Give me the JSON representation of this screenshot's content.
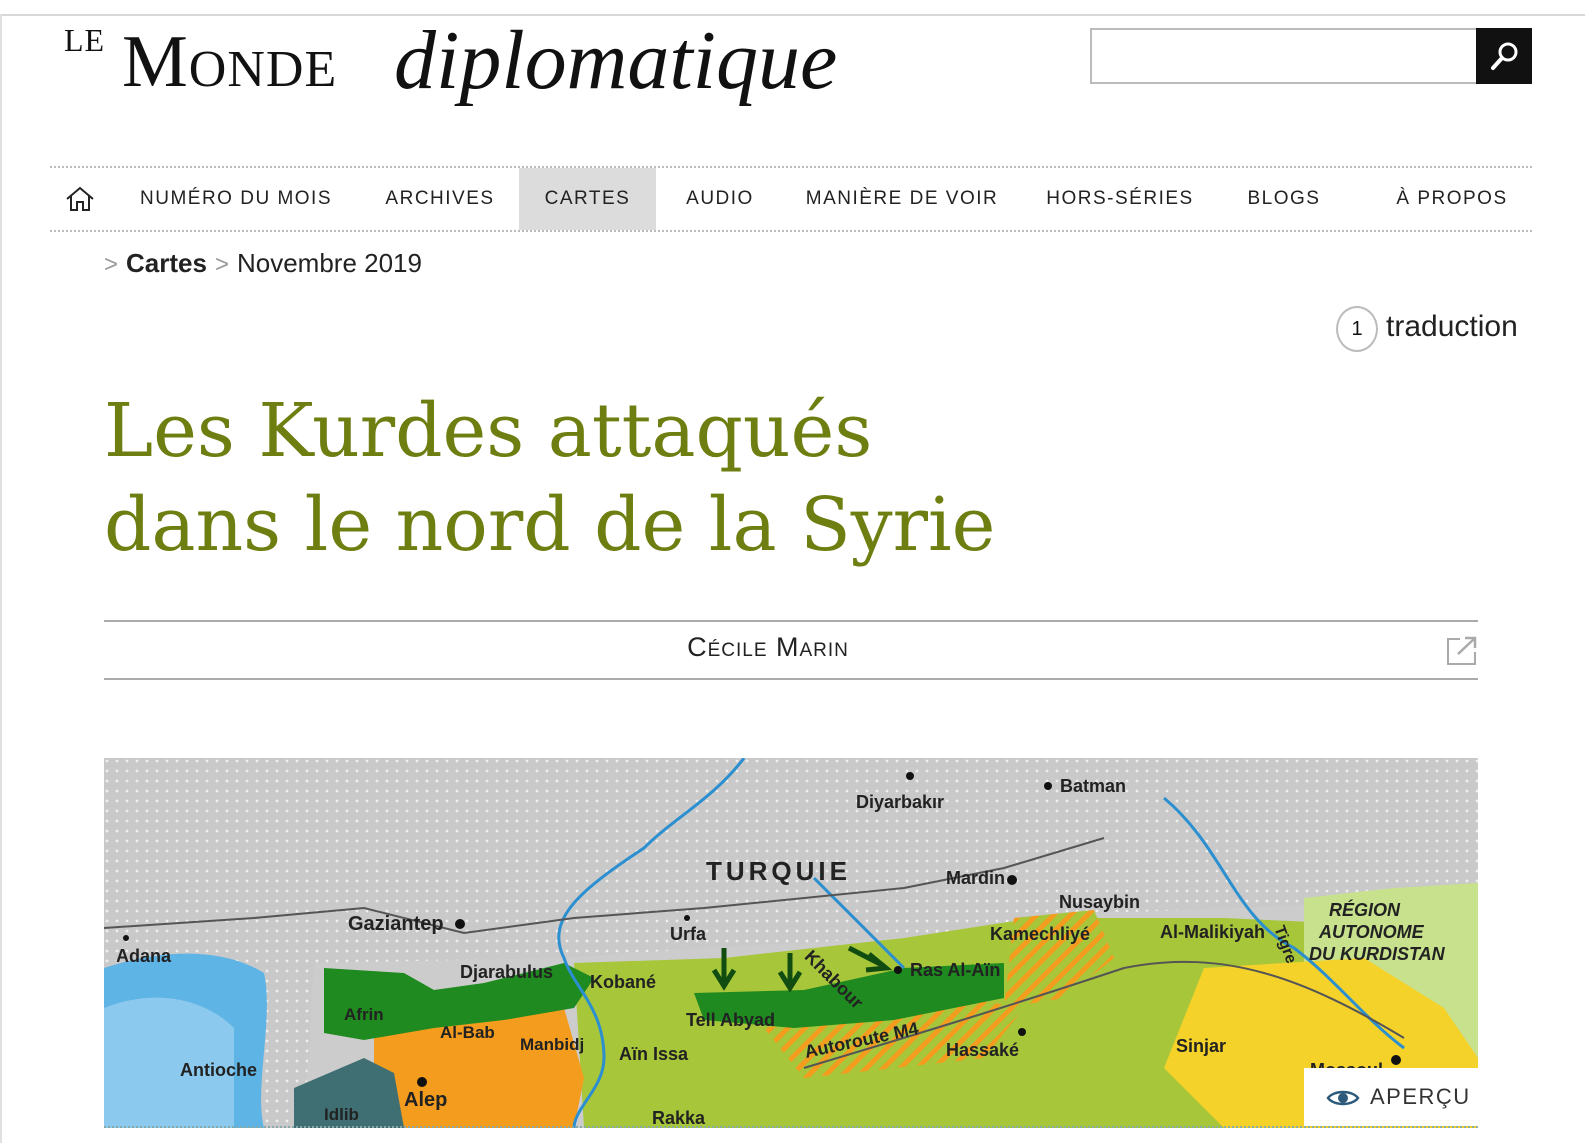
{
  "logo": {
    "le": "LE",
    "monde": "Monde",
    "diplomatique": "diplomatique"
  },
  "search": {
    "placeholder": "",
    "value": "",
    "icon": "search-icon"
  },
  "nav": {
    "home_icon": "home-icon",
    "items": [
      "NUMÉRO DU MOIS",
      "ARCHIVES",
      "CARTES",
      "AUDIO",
      "MANIÈRE DE VOIR",
      "HORS-SÉRIES",
      "BLOGS",
      "À PROPOS"
    ],
    "active": "CARTES"
  },
  "breadcrumb": {
    "section": "Cartes",
    "date": "Novembre 2019"
  },
  "translation": {
    "count": "1",
    "label": "traduction"
  },
  "article": {
    "title_line1": "Les Kurdes attaqués",
    "title_line2": "dans le nord de la Syrie",
    "author": "Cécile Marin",
    "external_icon": "external-link-icon"
  },
  "map": {
    "country": "TURQUIE",
    "region_line1": "RÉGION",
    "region_line2": "AUTONOME",
    "region_line3": "DU KURDISTAN",
    "cities": {
      "batman": "Batman",
      "diyarbakir": "Diyarbakır",
      "mardin": "Mardin",
      "nusaybin": "Nusaybin",
      "gaziantep": "Gaziantep",
      "urfa": "Urfa",
      "adana": "Adana",
      "djarabulus": "Djarabulus",
      "kobane": "Kobané",
      "kamechliye": "Kamechliyé",
      "almalikiyah": "Al-Malikiyah",
      "rasalain": "Ras Al-Aïn",
      "afrin": "Afrin",
      "albab": "Al-Bab",
      "manbidj": "Manbidj",
      "tellabyad": "Tell Abyad",
      "ainissa": "Aïn Issa",
      "hassake": "Hassaké",
      "sinjar": "Sinjar",
      "antioche": "Antioche",
      "alep": "Alep",
      "idlib": "Idlib",
      "rakka": "Rakka",
      "mossoul": "Mossoul"
    },
    "rivers": {
      "khabour": "Khabour",
      "tigre": "Tigre"
    },
    "road": "Autoroute M4"
  },
  "preview": {
    "label": "APERÇU",
    "icon": "eye-icon"
  },
  "colors": {
    "title": "#6e7e10",
    "nav_active_bg": "#dcdcdc",
    "dark_green": "#1f8a1f",
    "light_green": "#a8c63a",
    "orange": "#f39c1e",
    "yellow": "#f5d22a",
    "teal": "#3f6f72"
  }
}
